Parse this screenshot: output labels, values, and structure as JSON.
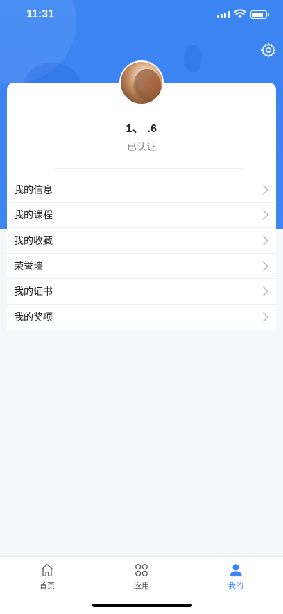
{
  "status_bar": {
    "time": "11:31"
  },
  "profile": {
    "username": "1、          .6",
    "verified_label": "已认证"
  },
  "menu": {
    "items": [
      {
        "label": "我的信息"
      },
      {
        "label": "我的课程"
      },
      {
        "label": "我的收藏"
      },
      {
        "label": "荣誉墙"
      },
      {
        "label": "我的证书"
      },
      {
        "label": "我的奖项"
      }
    ]
  },
  "tabbar": {
    "tabs": [
      {
        "label": "首页",
        "icon": "home-icon"
      },
      {
        "label": "应用",
        "icon": "apps-icon"
      },
      {
        "label": "我的",
        "icon": "user-icon"
      }
    ],
    "active": "我的"
  },
  "colors": {
    "accent": "#3b86f3",
    "header_bg": "#3d82f0",
    "page_bg": "#f7f8fb"
  }
}
